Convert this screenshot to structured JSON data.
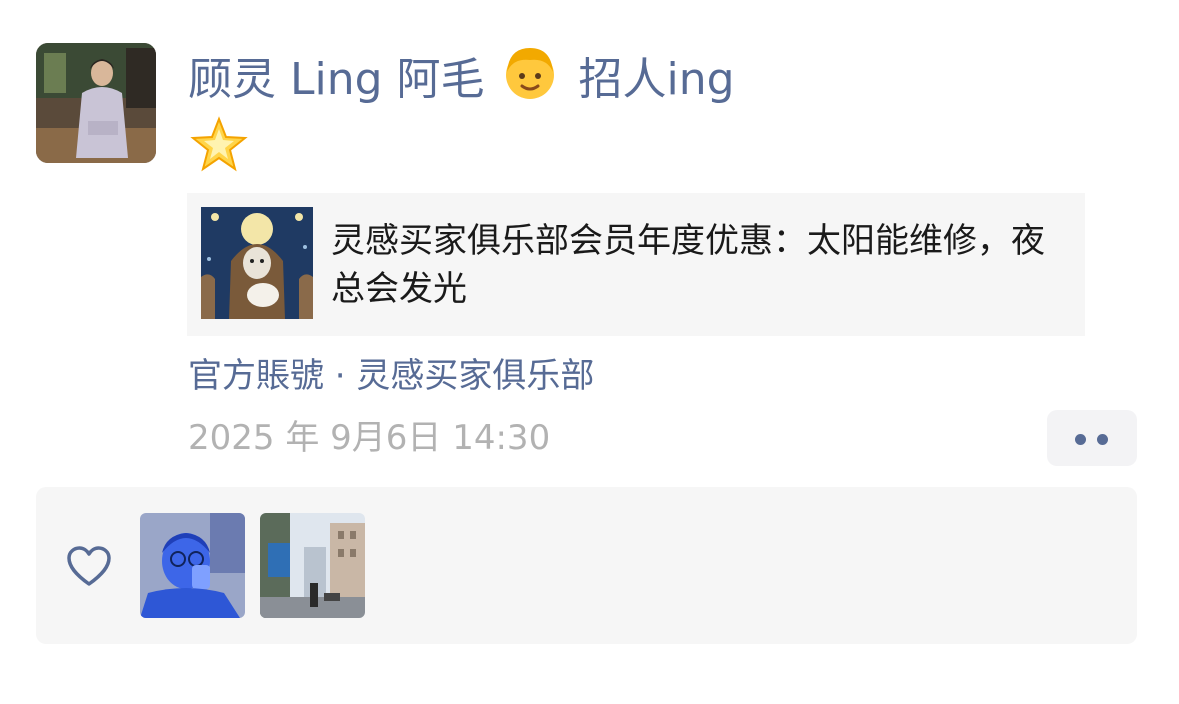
{
  "post": {
    "author_name": "顾灵 Ling 阿毛",
    "author_suffix": "招人ing",
    "author_emoji": "person-blond-hair-emoji",
    "body_emoji": "glowing-star-emoji",
    "link_card": {
      "title": "灵感买家俱乐部会员年度优惠：太阳能维修，夜总会发光",
      "thumbnail": "hooded-figure-holding-bird-illustration"
    },
    "source": "官方賬號 · 灵感买家俱乐部",
    "timestamp": "2025 年 9月6日 14:30"
  },
  "likes": {
    "icon": "heart-outline-icon",
    "likers": [
      {
        "avatar": "blue-tinted-person-drinking-photo"
      },
      {
        "avatar": "city-street-photo"
      }
    ]
  },
  "colors": {
    "link_blue": "#576b95",
    "timestamp_gray": "#b2b2b2",
    "panel_bg": "#f6f6f6"
  }
}
